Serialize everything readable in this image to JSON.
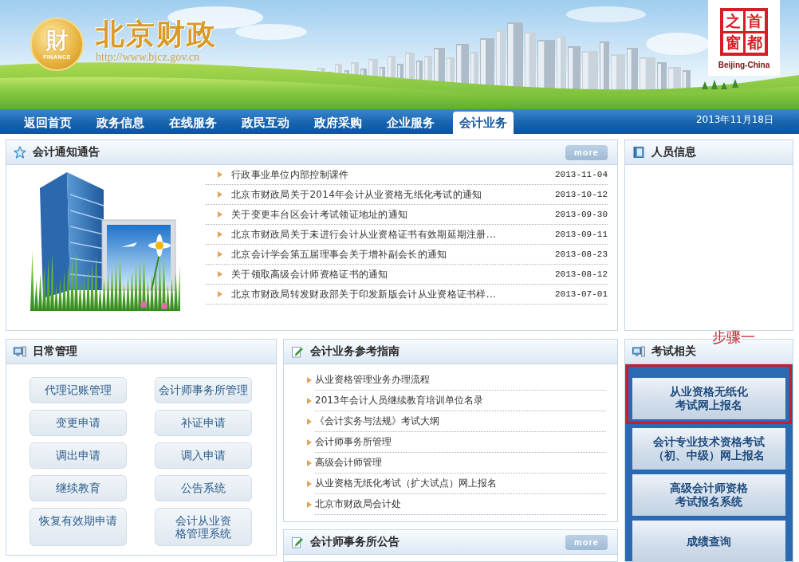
{
  "header": {
    "emblem": {
      "glyph": "財",
      "caption": "FINANCE"
    },
    "title": "北京财政",
    "url": "http://www.bjcz.gov.cn",
    "portal_badge": {
      "characters": "首都之窗",
      "caption": "Beijing-China"
    }
  },
  "nav": {
    "items": [
      {
        "label": "返回首页",
        "selected": false
      },
      {
        "label": "政务信息",
        "selected": false
      },
      {
        "label": "在线服务",
        "selected": false
      },
      {
        "label": "政民互动",
        "selected": false
      },
      {
        "label": "政府采购",
        "selected": false
      },
      {
        "label": "企业服务",
        "selected": false
      },
      {
        "label": "会计业务",
        "selected": true
      }
    ],
    "date": "2013年11月18日"
  },
  "notices": {
    "title": "会计通知通告",
    "more": "more",
    "items": [
      {
        "title": "行政事业单位内部控制课件",
        "date": "2013-11-04"
      },
      {
        "title": "北京市财政局关于2014年会计从业资格无纸化考试的通知",
        "date": "2013-10-12"
      },
      {
        "title": "关于变更丰台区会计考试领证地址的通知",
        "date": "2013-09-30"
      },
      {
        "title": "北京市财政局关于未进行会计从业资格证书有效期延期注册...",
        "date": "2013-09-11"
      },
      {
        "title": "北京会计学会第五届理事会关于增补副会长的通知",
        "date": "2013-08-23"
      },
      {
        "title": "关于领取高级会计师资格证书的通知",
        "date": "2013-08-12"
      },
      {
        "title": "北京市财政局转发财政部关于印发新版会计从业资格证书样...",
        "date": "2013-07-01"
      }
    ]
  },
  "personnel": {
    "title": "人员信息"
  },
  "daily": {
    "title": "日常管理",
    "buttons": [
      "代理记账管理",
      "会计师事务所管理",
      "变更申请",
      "补证申请",
      "调出申请",
      "调入申请",
      "继续教育",
      "公告系统",
      "恢复有效期申请",
      "会计从业资格管理系统"
    ]
  },
  "guide": {
    "title": "会计业务参考指南",
    "items": [
      "从业资格管理业务办理流程",
      "2013年会计人员继续教育培训单位名录",
      "《会计实务与法规》考试大纲",
      "会计师事务所管理",
      "高级会计师管理",
      "从业资格无纸化考试（扩大试点）网上报名",
      "北京市财政局会计处"
    ]
  },
  "firm_notices": {
    "title": "会计师事务所公告",
    "more": "more"
  },
  "exam": {
    "title": "考试相关",
    "annotation": "步骤一",
    "buttons": [
      {
        "label": "从业资格无纸化考试网上报名",
        "highlighted": true
      },
      {
        "label": "会计专业技术资格考试（初、中级）网上报名",
        "highlighted": false
      },
      {
        "label": "高级会计师资格考试报名系统",
        "highlighted": false
      },
      {
        "label": "成绩查询",
        "highlighted": false
      }
    ]
  }
}
